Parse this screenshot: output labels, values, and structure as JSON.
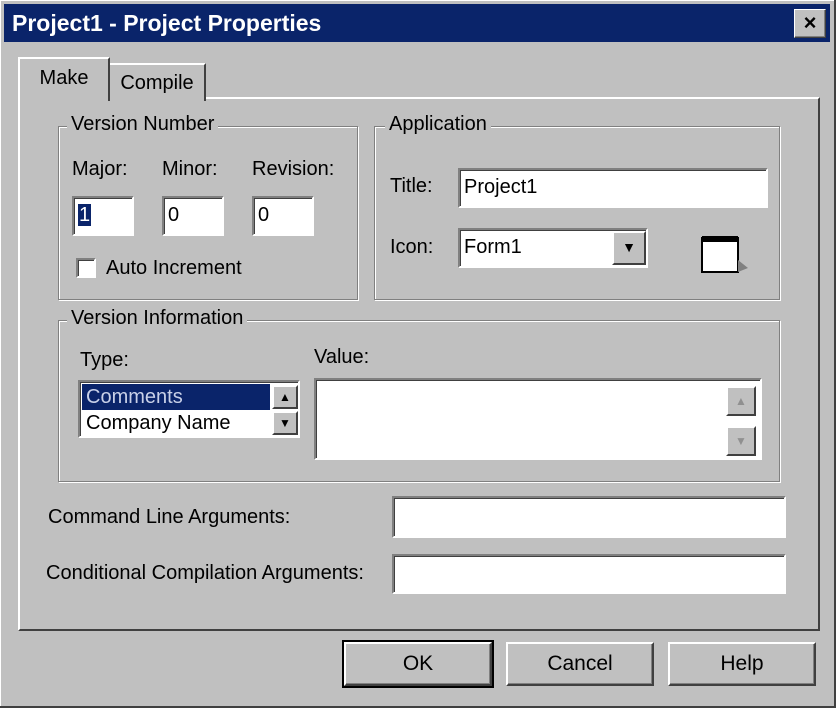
{
  "window": {
    "title": "Project1 - Project Properties",
    "close_glyph": "×"
  },
  "tabs": [
    {
      "label": "Make",
      "active": true
    },
    {
      "label": "Compile",
      "active": false
    }
  ],
  "version_number": {
    "group_title": "Version Number",
    "major_label": "Major:",
    "minor_label": "Minor:",
    "revision_label": "Revision:",
    "major_value": "1",
    "minor_value": "0",
    "revision_value": "0",
    "auto_increment_label": "Auto Increment",
    "auto_increment_checked": false
  },
  "application": {
    "group_title": "Application",
    "title_label": "Title:",
    "title_value": "Project1",
    "icon_label": "Icon:",
    "icon_value": "Form1",
    "icon_preview": "form-icon"
  },
  "version_information": {
    "group_title": "Version Information",
    "type_label": "Type:",
    "value_label": "Value:",
    "type_options": [
      "Comments",
      "Company Name"
    ],
    "selected_type": "Comments",
    "value_text": ""
  },
  "command_line": {
    "label": "Command Line Arguments:",
    "value": ""
  },
  "conditional_compilation": {
    "label": "Conditional Compilation Arguments:",
    "value": ""
  },
  "buttons": {
    "ok": "OK",
    "cancel": "Cancel",
    "help": "Help"
  },
  "colors": {
    "titlebar": "#0a246a",
    "face": "#c0c0c0",
    "selection": "#0a246a"
  }
}
